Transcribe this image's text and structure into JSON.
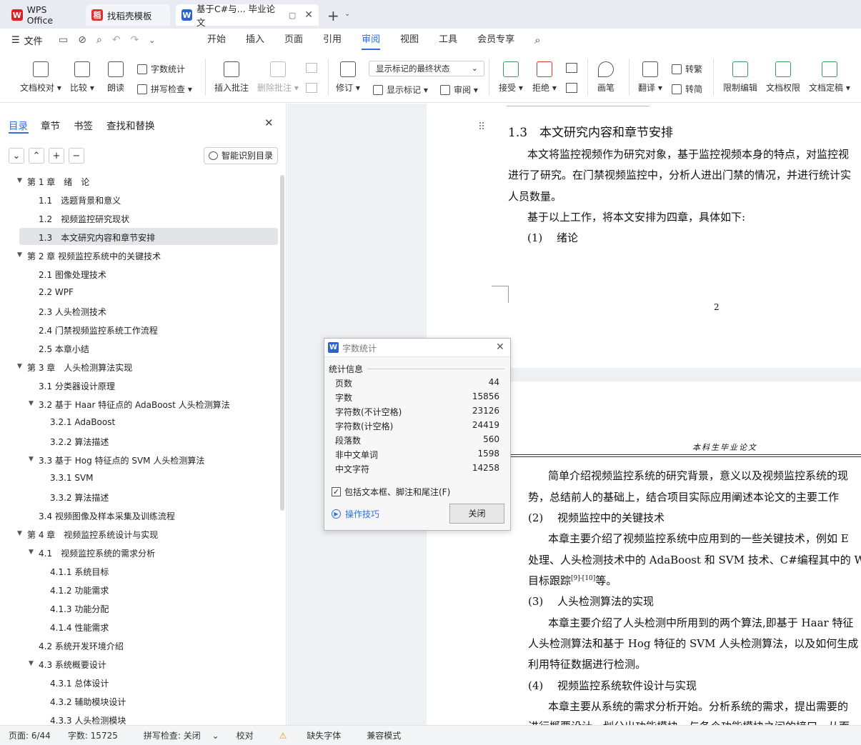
{
  "tabs": [
    {
      "label": "WPS Office",
      "color": "#e02020"
    },
    {
      "label": "找稻壳模板",
      "color": "#e03030"
    },
    {
      "label": "基于C#与... 毕业论文",
      "color": "#2a62d8"
    }
  ],
  "menu": {
    "file": "文件",
    "items": [
      "开始",
      "插入",
      "页面",
      "引用",
      "审阅",
      "视图",
      "工具",
      "会员专享"
    ],
    "active": "审阅"
  },
  "ribbon": {
    "proofread": "文档校对",
    "compare": "比较",
    "read": "朗读",
    "wordcount": "字数统计",
    "spellcheck": "拼写检查",
    "insert_comment": "插入批注",
    "delete_comment": "删除批注",
    "revise": "修订",
    "markup_state": "显示标记的最终状态",
    "show_markup": "显示标记",
    "review": "审阅",
    "accept": "接受",
    "reject": "拒绝",
    "pen": "画笔",
    "translate": "翻译",
    "to_trad": "转繁",
    "to_simp": "转简",
    "restrict": "限制编辑",
    "permission": "文档权限",
    "finalize": "文档定稿"
  },
  "nav": {
    "tabs": [
      "目录",
      "章节",
      "书签",
      "查找和替换"
    ],
    "smart_btn": "智能识别目录",
    "toc": [
      {
        "text": "第 1 章　绪　论",
        "level": 0,
        "expanded": true
      },
      {
        "text": "1.1　选题背景和意义",
        "level": 1
      },
      {
        "text": "1.2　视频监控研究现状",
        "level": 1
      },
      {
        "text": "1.3　本文研究内容和章节安排",
        "level": 1,
        "selected": true
      },
      {
        "text": "第 2 章  视频监控系统中的关键技术",
        "level": 0,
        "expanded": true
      },
      {
        "text": "2.1 图像处理技术",
        "level": 1
      },
      {
        "text": "2.2 WPF",
        "level": 1
      },
      {
        "text": "2.3  人头检测技术",
        "level": 1
      },
      {
        "text": "2.4  门禁视频监控系统工作流程",
        "level": 1
      },
      {
        "text": "2.5  本章小结",
        "level": 1
      },
      {
        "text": "第 3 章　人头检测算法实现",
        "level": 0,
        "expanded": true
      },
      {
        "text": "3.1  分类器设计原理",
        "level": 1
      },
      {
        "text": "3.2  基于 Haar 特征点的 AdaBoost 人头检测算法",
        "level": 1,
        "expanded": true
      },
      {
        "text": "3.2.1 AdaBoost",
        "level": 2
      },
      {
        "text": "3.2.2  算法描述",
        "level": 2
      },
      {
        "text": "3.3  基于 Hog 特征点的 SVM 人头检测算法",
        "level": 1,
        "expanded": true
      },
      {
        "text": "3.3.1 SVM",
        "level": 2
      },
      {
        "text": "3.3.2  算法描述",
        "level": 2
      },
      {
        "text": "3.4  视频图像及样本采集及训练流程",
        "level": 1
      },
      {
        "text": "第 4 章　视频监控系统设计与实现",
        "level": 0,
        "expanded": true
      },
      {
        "text": "4.1　视频监控系统的需求分析",
        "level": 1,
        "expanded": true
      },
      {
        "text": "4.1.1  系统目标",
        "level": 2
      },
      {
        "text": "4.1.2  功能需求",
        "level": 2
      },
      {
        "text": "4.1.3  功能分配",
        "level": 2
      },
      {
        "text": "4.1.4  性能需求",
        "level": 2
      },
      {
        "text": "4.2  系统开发环境介绍",
        "level": 1
      },
      {
        "text": "4.3 系统概要设计",
        "level": 1,
        "expanded": true
      },
      {
        "text": "4.3.1  总体设计",
        "level": 2
      },
      {
        "text": "4.3.2  辅助模块设计",
        "level": 2
      },
      {
        "text": "4.3.3  人头检测模块",
        "level": 2
      }
    ]
  },
  "doc": {
    "heading": "1.3　本文研究内容和章节安排",
    "p1": "本文将监控视频作为研究对象，基于监控视频本身的特点，对监控视",
    "p1b": "进行了研究。在门禁视频监控中，分析人进出门禁的情况，并进行统计实",
    "p1c": "人员数量。",
    "p2": "基于以上工作，将本文安排为四章，具体如下:",
    "item1": "(1)　 绪论",
    "page_number": "2",
    "header": "本科生毕业论文",
    "p3": "简单介绍视频监控系统的研究背景，意义以及视频监控系统的现",
    "p3b": "势，总结前人的基础上，结合项目实际应用阐述本论文的主要工作",
    "item2": "(2)　 视频监控中的关键技术",
    "p4": "本章主要介绍了视频监控系统中应用到的一些关键技术，例如 E",
    "p4b": "处理、人头检测技术中的 AdaBoost 和 SVM 技术、C#编程其中的 WI",
    "p4c": "目标跟踪",
    "p4c_sup": "[9]-[10]",
    "p4c_end": "等。",
    "item3": "(3)　 人头检测算法的实现",
    "p5": "本章主要介绍了人头检测中所用到的两个算法,即基于 Haar 特征",
    "p5b": "人头检测算法和基于 Hog 特征的 SVM 人头检测算法，以及如何生成",
    "p5c": "利用特征数据进行检测。",
    "item4": "(4)　 视频监控系统软件设计与实现",
    "p6": "本章主要从系统的需求分析开始。分析系统的需求，提出需要的",
    "p6b": "进行概要设计，划分出功能模块，与各个功能模块之间的接口，从而"
  },
  "dialog": {
    "title": "字数统计",
    "section": "统计信息",
    "rows": [
      {
        "k": "页数",
        "v": "44"
      },
      {
        "k": "字数",
        "v": "15856"
      },
      {
        "k": "字符数(不计空格)",
        "v": "23126"
      },
      {
        "k": "字符数(计空格)",
        "v": "24419"
      },
      {
        "k": "段落数",
        "v": "560"
      },
      {
        "k": "非中文单词",
        "v": "1598"
      },
      {
        "k": "中文字符",
        "v": "14258"
      }
    ],
    "checkbox": "包括文本框、脚注和尾注(F)",
    "tips": "操作技巧",
    "close": "关闭"
  },
  "status": {
    "page": "页面: 6/44",
    "words": "字数: 15725",
    "spell": "拼写检查: 关闭",
    "proof": "校对",
    "font": "缺失字体",
    "compat": "兼容模式"
  }
}
